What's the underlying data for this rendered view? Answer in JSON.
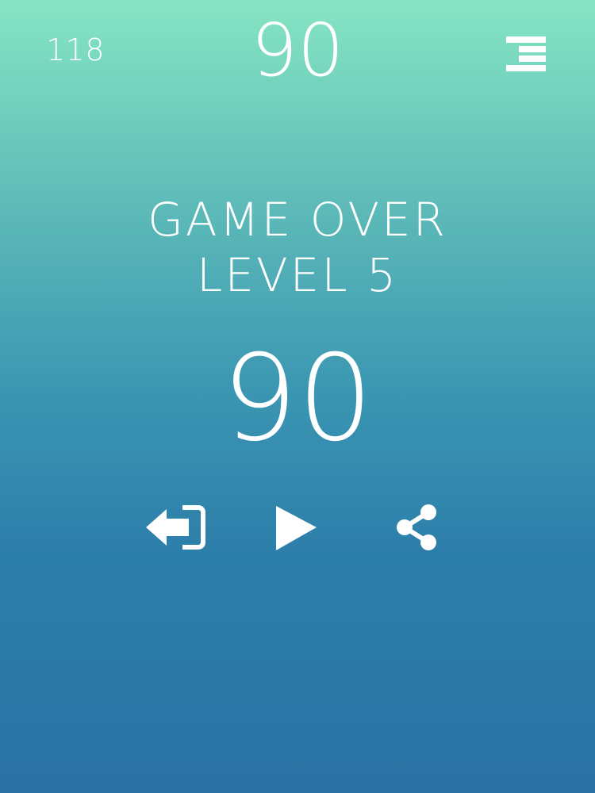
{
  "hud": {
    "best_score": "118",
    "current_score": "90",
    "menu_icon": "menu-bars-icon"
  },
  "game_over": {
    "title": "GAME OVER",
    "level": "LEVEL 5",
    "final_score": "90"
  },
  "actions": {
    "exit_icon": "exit-arrow-icon",
    "play_icon": "play-icon",
    "share_icon": "share-icon"
  },
  "colors": {
    "gradient_top": "#86e5c3",
    "gradient_mid": "#3a95b2",
    "gradient_bottom": "#2a72a4",
    "foreground": "#ffffff"
  }
}
